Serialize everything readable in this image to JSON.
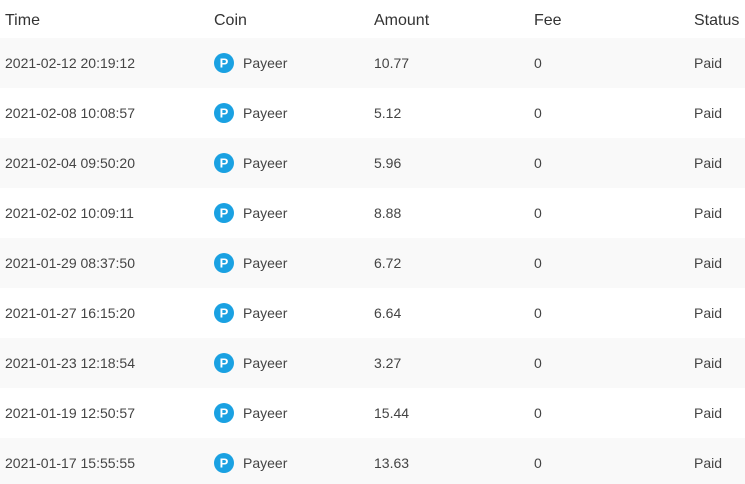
{
  "table": {
    "columns": {
      "time": "Time",
      "coin": "Coin",
      "amount": "Amount",
      "fee": "Fee",
      "status": "Status"
    },
    "rows": [
      {
        "time": "2021-02-12 20:19:12",
        "coin": "Payeer",
        "amount": "10.77",
        "fee": "0",
        "status": "Paid"
      },
      {
        "time": "2021-02-08 10:08:57",
        "coin": "Payeer",
        "amount": "5.12",
        "fee": "0",
        "status": "Paid"
      },
      {
        "time": "2021-02-04 09:50:20",
        "coin": "Payeer",
        "amount": "5.96",
        "fee": "0",
        "status": "Paid"
      },
      {
        "time": "2021-02-02 10:09:11",
        "coin": "Payeer",
        "amount": "8.88",
        "fee": "0",
        "status": "Paid"
      },
      {
        "time": "2021-01-29 08:37:50",
        "coin": "Payeer",
        "amount": "6.72",
        "fee": "0",
        "status": "Paid"
      },
      {
        "time": "2021-01-27 16:15:20",
        "coin": "Payeer",
        "amount": "6.64",
        "fee": "0",
        "status": "Paid"
      },
      {
        "time": "2021-01-23 12:18:54",
        "coin": "Payeer",
        "amount": "3.27",
        "fee": "0",
        "status": "Paid"
      },
      {
        "time": "2021-01-19 12:50:57",
        "coin": "Payeer",
        "amount": "15.44",
        "fee": "0",
        "status": "Paid"
      },
      {
        "time": "2021-01-17 15:55:55",
        "coin": "Payeer",
        "amount": "13.63",
        "fee": "0",
        "status": "Paid"
      }
    ]
  },
  "icons": {
    "coin": "payeer-icon"
  },
  "colors": {
    "payeer_blue": "#1aa1e2",
    "striped_row": "#f9f9f9"
  }
}
